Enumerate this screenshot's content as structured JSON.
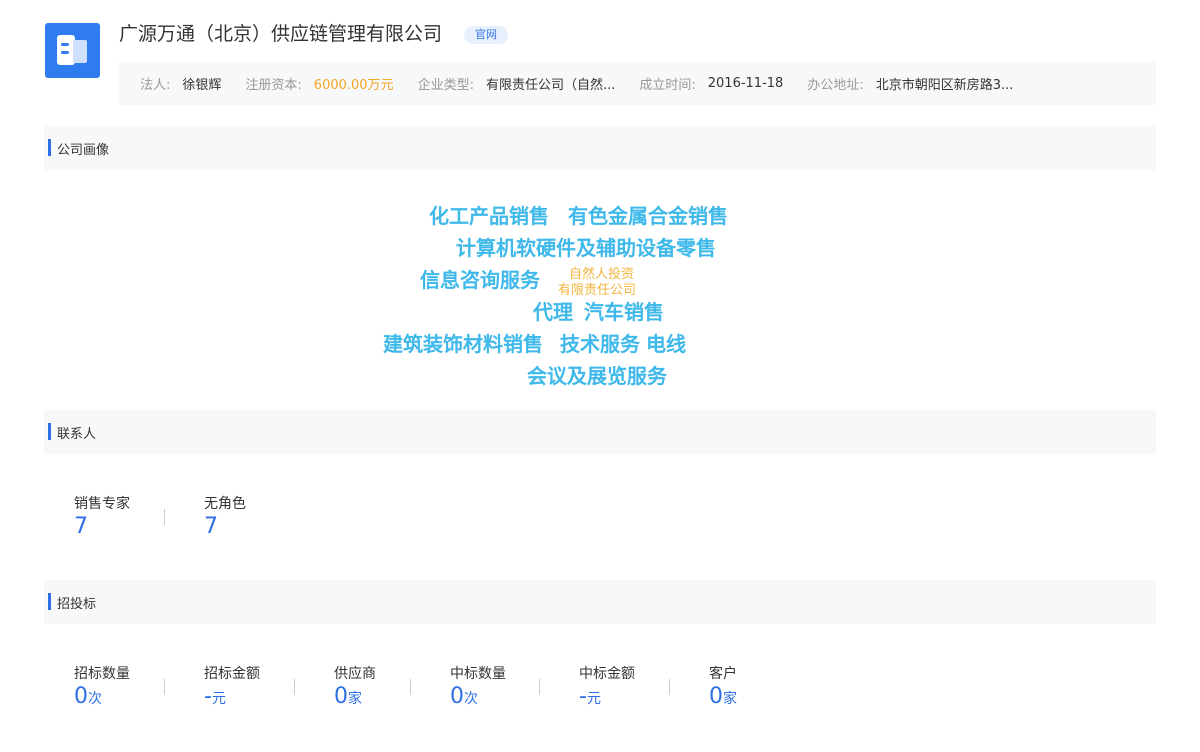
{
  "company": {
    "name": "广源万通（北京）供应链管理有限公司",
    "official_tag": "官网",
    "logo_icon": "building-icon",
    "accent": "#2f7bf0"
  },
  "info": {
    "legal_rep_label": "法人:",
    "legal_rep": "徐银辉",
    "capital_label": "注册资本:",
    "capital": "6000.00万元",
    "type_label": "企业类型:",
    "type": "有限责任公司（自然...",
    "founded_label": "成立时间:",
    "founded": "2016-11-18",
    "address_label": "办公地址:",
    "address": "北京市朝阳区新房路3..."
  },
  "portrait": {
    "title": "公司画像",
    "words": [
      "化工产品销售",
      "有色金属合金销售",
      "计算机软硬件及辅助设备零售",
      "信息咨询服务",
      "自然人投资",
      "有限责任公司",
      "代理",
      "汽车销售",
      "建筑装饰材料销售",
      "技术服务",
      "电线",
      "会议及展览服务"
    ]
  },
  "contacts": {
    "title": "联系人",
    "stats": [
      {
        "label": "销售专家",
        "value": "7"
      },
      {
        "label": "无角色",
        "value": "7"
      }
    ]
  },
  "bidding": {
    "title": "招投标",
    "stats": [
      {
        "label": "招标数量",
        "value": "0",
        "unit": "次"
      },
      {
        "label": "招标金额",
        "value": "-",
        "unit": "元"
      },
      {
        "label": "供应商",
        "value": "0",
        "unit": "家"
      },
      {
        "label": "中标数量",
        "value": "0",
        "unit": "次"
      },
      {
        "label": "中标金额",
        "value": "-",
        "unit": "元"
      },
      {
        "label": "客户",
        "value": "0",
        "unit": "家"
      }
    ]
  },
  "colors": {
    "accent_blue": "#2f6fe5",
    "cloud_blue": "#3fb8ea",
    "cloud_orange": "#f3b63f",
    "capital_orange": "#f5a623"
  }
}
